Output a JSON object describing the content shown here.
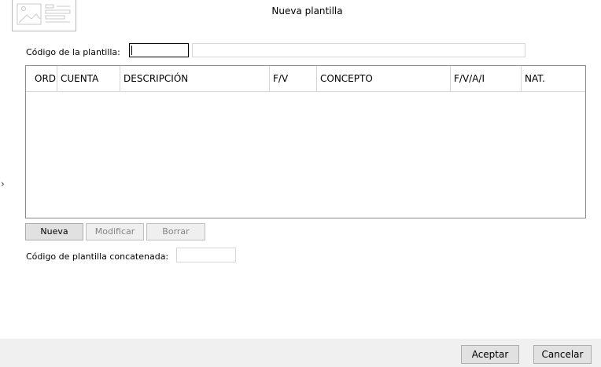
{
  "window": {
    "title": "Nueva plantilla"
  },
  "form": {
    "code_label": "Código de la plantilla:",
    "code_value": "",
    "description_value": "",
    "chained_label": "Código de plantilla concatenada:",
    "chained_value": ""
  },
  "grid": {
    "columns": [
      "ORD",
      "CUENTA",
      "DESCRIPCIÓN",
      "F/V",
      "CONCEPTO",
      "F/V/A/I",
      "NAT."
    ],
    "rows": []
  },
  "grid_buttons": {
    "new_label": "Nueva",
    "modify_label": "Modificar",
    "delete_label": "Borrar"
  },
  "side_panel": {
    "expand_glyph": "›"
  },
  "footer": {
    "accept_label": "Aceptar",
    "cancel_label": "Cancelar"
  },
  "icons": {
    "template": "template-icon",
    "expand": "chevron-right-icon"
  }
}
